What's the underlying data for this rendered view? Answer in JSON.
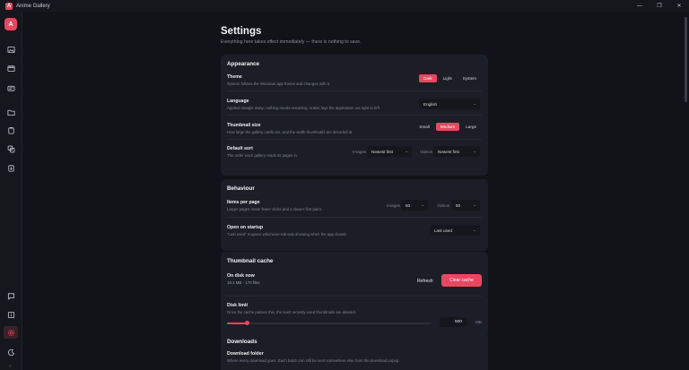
{
  "app": {
    "title": "Anime Gallery",
    "icon_letter": "A"
  },
  "window_controls": [
    "—",
    "❐",
    "✕"
  ],
  "sidebar": {
    "avatar_letter": "A",
    "items": [
      {
        "icon": "image-icon"
      },
      {
        "icon": "film-icon"
      },
      {
        "icon": "id-card-icon"
      },
      {
        "icon": "folder-icon"
      },
      {
        "icon": "clipboard-icon"
      },
      {
        "icon": "copy-icon"
      },
      {
        "icon": "download-clipboard-icon"
      }
    ],
    "bottom_items": [
      {
        "icon": "chat-icon"
      },
      {
        "icon": "info-icon"
      },
      {
        "icon": "gear-icon",
        "active": true
      },
      {
        "icon": "moon-icon"
      }
    ],
    "bottom_mark": "»"
  },
  "page": {
    "title": "Settings",
    "subtitle": "Everything here takes effect immediately — there is nothing to save."
  },
  "appearance": {
    "title": "Appearance",
    "theme": {
      "label": "Theme",
      "desc": "System follows the Windows app theme and changes with it.",
      "options": [
        "Dark",
        "Light",
        "System"
      ],
      "selected": "Dark"
    },
    "language": {
      "label": "Language",
      "desc": "Applied straight away; nothing needs restarting. Arabic lays the application out right to left.",
      "value": "English"
    },
    "thumb_size": {
      "label": "Thumbnail size",
      "desc": "How large the gallery cards are, and the width thumbnails are decoded at.",
      "options": [
        "Small",
        "Medium",
        "Large"
      ],
      "selected": "Medium"
    },
    "default_sort": {
      "label": "Default sort",
      "desc": "The order each gallery reads its pages in.",
      "images_label": "Images",
      "images_value": "Newest first",
      "videos_label": "Videos",
      "videos_value": "Newest first"
    }
  },
  "behaviour": {
    "title": "Behaviour",
    "items_per_page": {
      "label": "Items per page",
      "desc": "Larger pages mean fewer clicks and a slower first paint.",
      "images_label": "Images",
      "images_value": "50",
      "videos_label": "Videos",
      "videos_value": "50"
    },
    "open_on_startup": {
      "label": "Open on startup",
      "desc": "\"Last used\" reopens whichever tab was showing when the app closed.",
      "value": "Last used"
    }
  },
  "thumbnail_cache": {
    "title": "Thumbnail cache",
    "on_disk": {
      "label": "On disk now",
      "desc": "10.1 MB · 170 files",
      "refresh_label": "Refresh",
      "clear_label": "Clear cache"
    },
    "disk_limit": {
      "label": "Disk limit",
      "desc": "Once the cache passes this, the least recently used thumbnails are deleted.",
      "value": "500",
      "unit": "MB",
      "slider_fraction": 0.1
    }
  },
  "downloads": {
    "title": "Downloads",
    "folder": {
      "label": "Download folder",
      "desc": "Where every download goes. Each batch can still be sent somewhere else from the download popup."
    }
  },
  "colors": {
    "accent": "#e8485f",
    "bg": "#111319",
    "card": "#1b1e26"
  }
}
